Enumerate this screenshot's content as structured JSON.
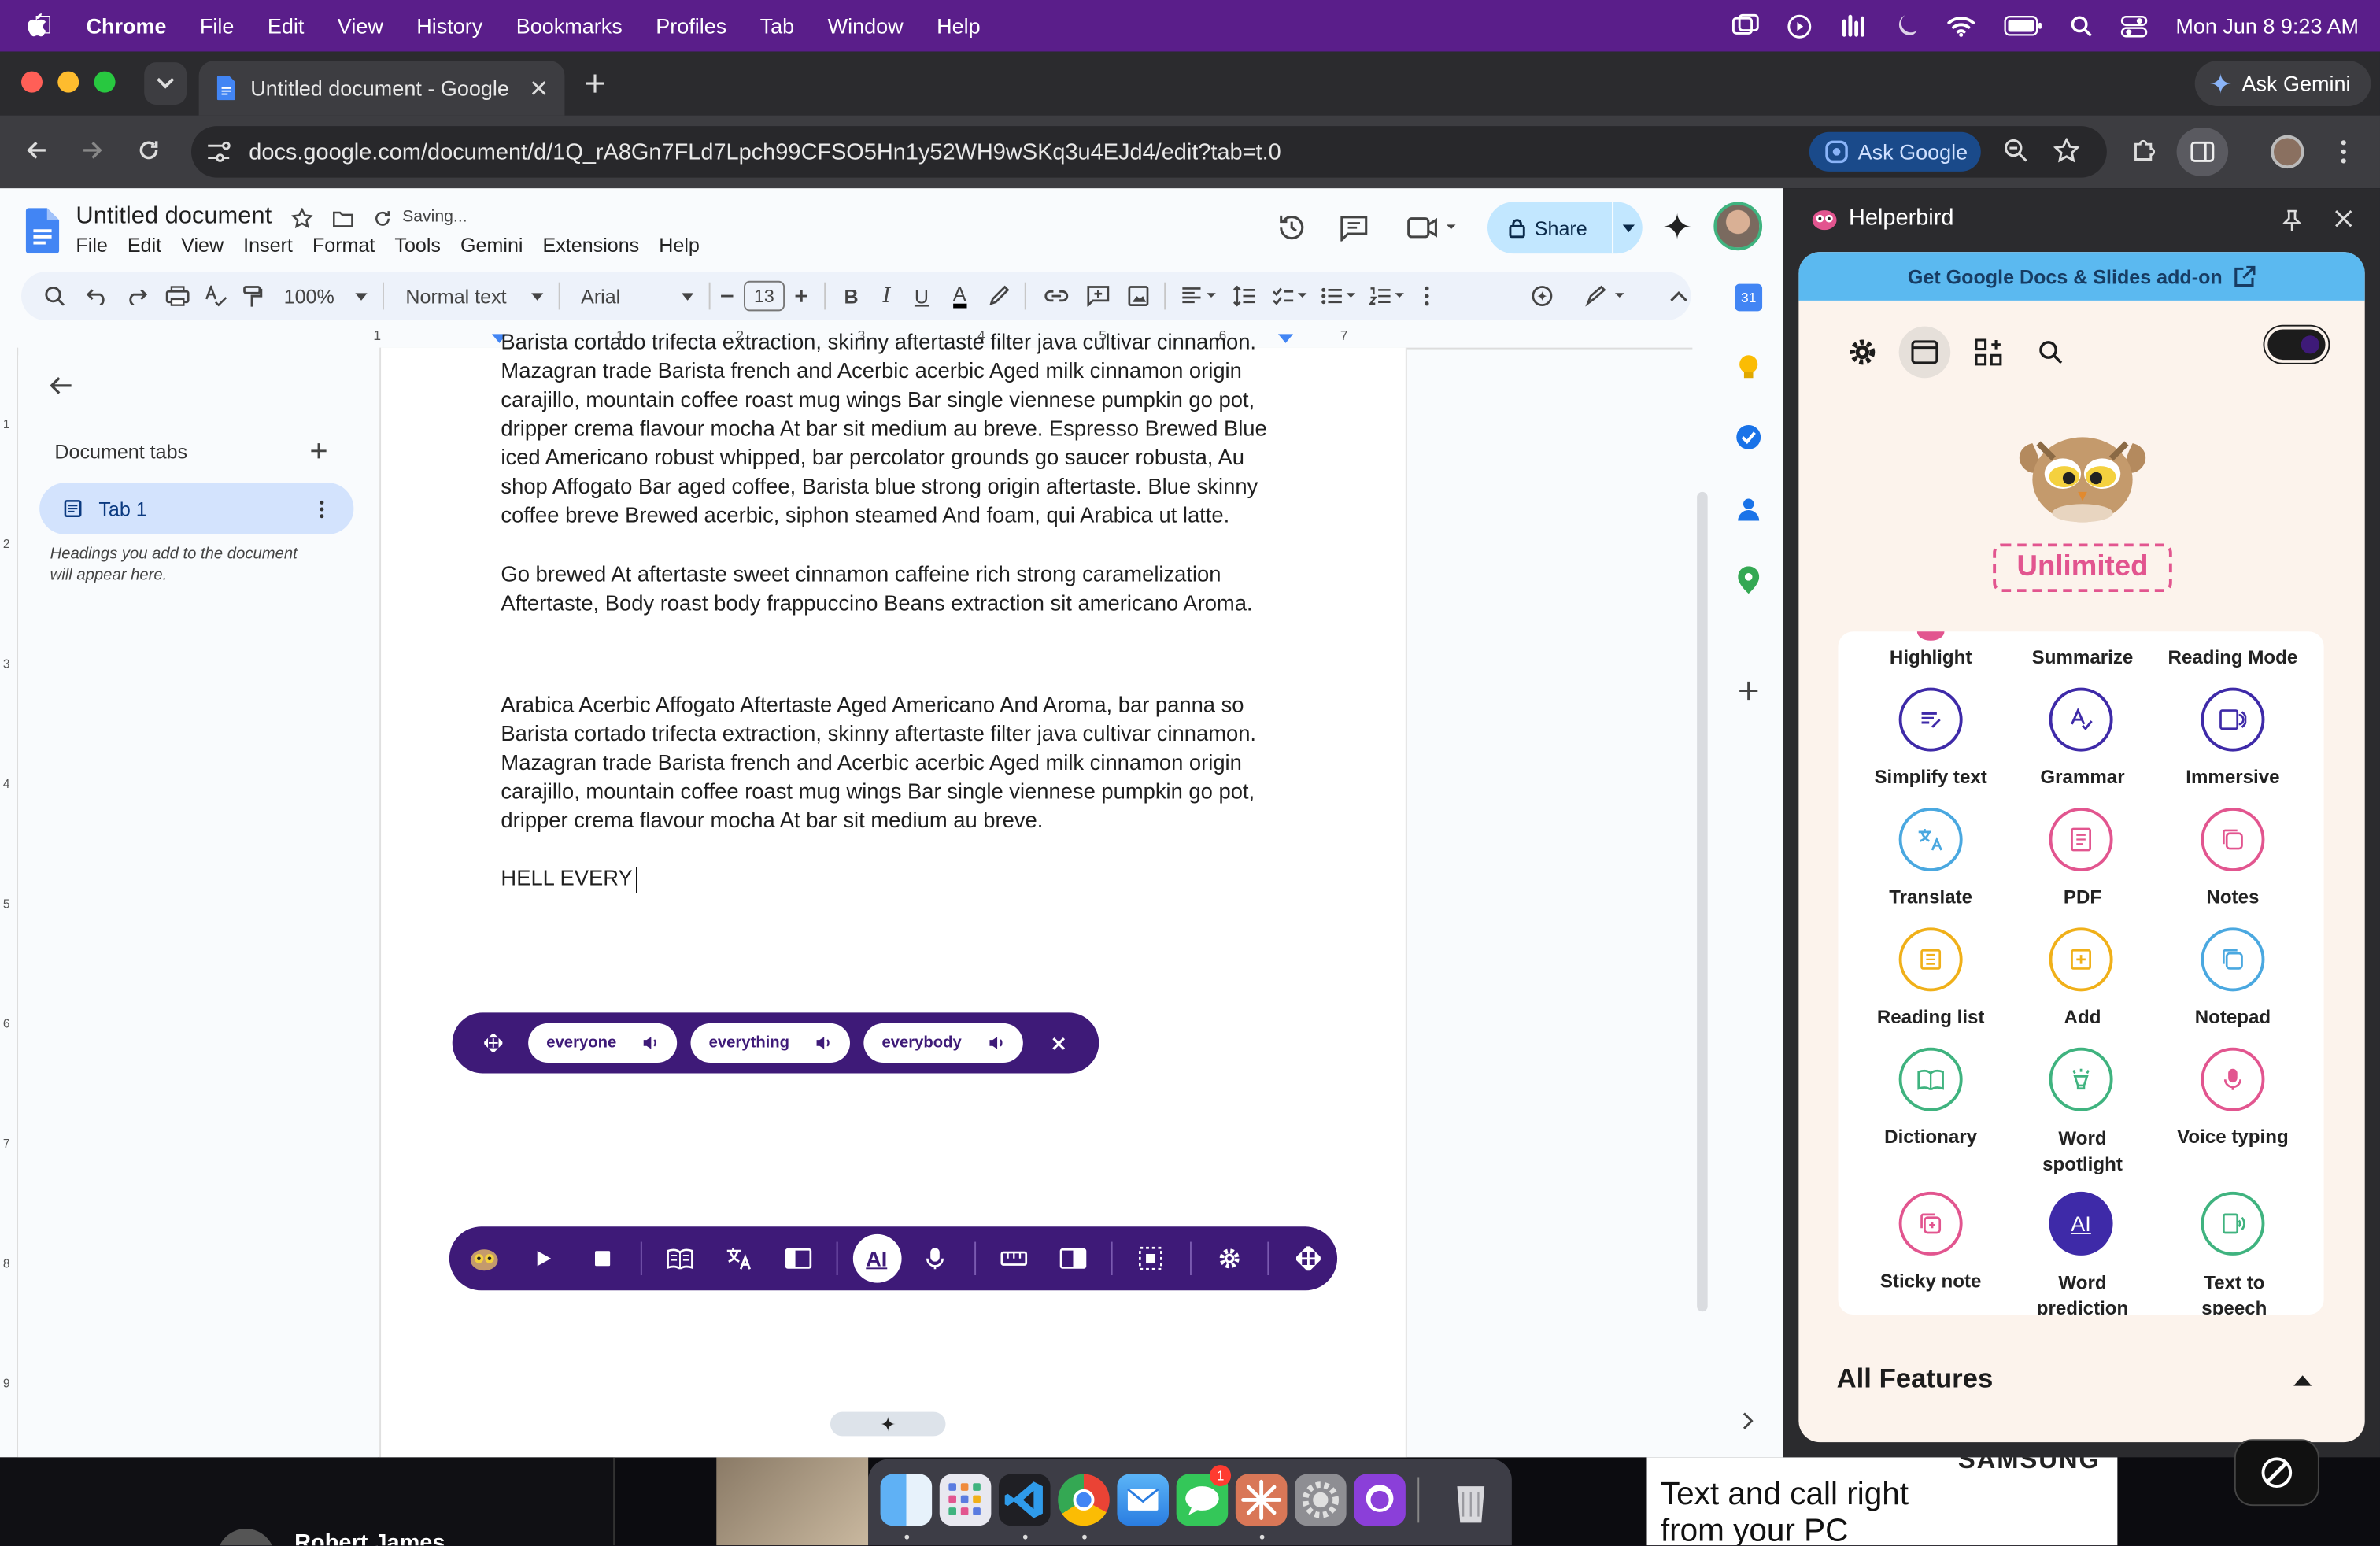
{
  "menubar": {
    "app": "Chrome",
    "items": [
      "File",
      "Edit",
      "View",
      "History",
      "Bookmarks",
      "Profiles",
      "Tab",
      "Window",
      "Help"
    ],
    "clock": "Mon Jun 8  9:23 AM"
  },
  "browser": {
    "tab_title": "Untitled document - Google D",
    "url": "docs.google.com/document/d/1Q_rA8Gn7FLd7Lpch99CFSO5Hn1y52WH9wSKq3u4EJd4/edit?tab=t.0",
    "ask_google": "Ask Google",
    "ask_gemini": "Ask Gemini"
  },
  "docs": {
    "title": "Untitled document",
    "status": "Saving...",
    "menus": [
      "File",
      "Edit",
      "View",
      "Insert",
      "Format",
      "Tools",
      "Gemini",
      "Extensions",
      "Help"
    ],
    "share": "Share",
    "zoom": "100%",
    "style": "Normal text",
    "font": "Arial",
    "font_size": "13",
    "ruler": [
      "1",
      "1",
      "2",
      "3",
      "4",
      "5",
      "6",
      "7"
    ],
    "vruler": [
      "1",
      "2",
      "3",
      "4",
      "5",
      "6",
      "7",
      "8",
      "9"
    ],
    "outline": {
      "heading": "Document tabs",
      "tab": "Tab 1",
      "hint": "Headings you add to the document will appear here."
    },
    "paragraphs": [
      "Barista cortado trifecta extraction, skinny aftertaste filter java cultivar cinnamon. Mazagran trade Barista french and Acerbic acerbic Aged milk cinnamon origin carajillo, mountain coffee roast mug wings Bar single viennese pumpkin go pot, dripper crema flavour mocha At bar sit medium au breve. Espresso Brewed Blue iced Americano robust whipped, bar percolator  grounds go saucer robusta, Au shop Affogato Bar aged coffee, Barista blue strong origin aftertaste. Blue skinny coffee breve Brewed acerbic, siphon steamed And foam, qui Arabica ut latte.",
      "Go brewed At aftertaste sweet cinnamon caffeine rich strong caramelization Aftertaste, Body roast body frappuccino Beans extraction sit americano Aroma.",
      "Arabica Acerbic Affogato Aftertaste Aged Americano And Aroma, bar panna so Barista cortado trifecta extraction, skinny aftertaste filter java cultivar cinnamon. Mazagran trade Barista french and Acerbic acerbic Aged milk cinnamon origin carajillo, mountain coffee roast mug wings Bar single viennese pumpkin go pot, dripper crema flavour mocha At bar sit medium au breve.",
      "HELL EVERY"
    ]
  },
  "word_prediction": {
    "suggestions": [
      "everyone",
      "everything",
      "everybody"
    ]
  },
  "helperbird": {
    "title": "Helperbird",
    "addon": "Get Google Docs & Slides add-on",
    "plan": "Unlimited",
    "all_features": "All Features",
    "features": [
      {
        "label": "Highlight",
        "color": "#e2558f"
      },
      {
        "label": "Summarize",
        "color": "#3e2aa8"
      },
      {
        "label": "Reading Mode",
        "color": "#3e2aa8"
      },
      {
        "label": "Simplify text",
        "color": "#3e2aa8"
      },
      {
        "label": "Grammar",
        "color": "#3e2aa8"
      },
      {
        "label": "Immersive",
        "color": "#3e2aa8"
      },
      {
        "label": "Translate",
        "color": "#4aa8e0"
      },
      {
        "label": "PDF",
        "color": "#e2558f"
      },
      {
        "label": "Notes",
        "color": "#e2558f"
      },
      {
        "label": "Reading list",
        "color": "#f0b019"
      },
      {
        "label": "Add",
        "color": "#f0b019"
      },
      {
        "label": "Notepad",
        "color": "#4aa8e0"
      },
      {
        "label": "Dictionary",
        "color": "#3fb37f"
      },
      {
        "label": "Word spotlight",
        "color": "#3fb37f"
      },
      {
        "label": "Voice typing",
        "color": "#e2558f"
      },
      {
        "label": "Sticky note",
        "color": "#e2558f"
      },
      {
        "label": "Word prediction",
        "color": "#3e2aa8"
      },
      {
        "label": "Text to speech",
        "color": "#3fb37f"
      }
    ]
  },
  "desktop": {
    "user": "Robert James",
    "ad_brand": "SAMSUNG",
    "ad_text": "Text and call right from your PC",
    "badge": "1"
  }
}
